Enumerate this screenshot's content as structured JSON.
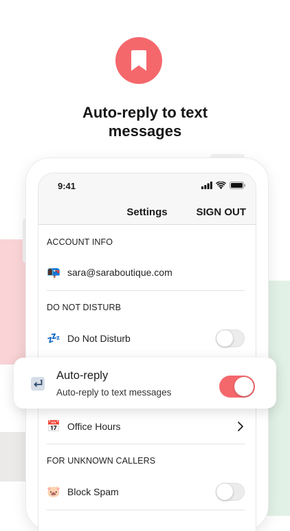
{
  "hero": {
    "icon": "bookmark-icon",
    "accent": "#f4686c",
    "headline_line1": "Auto-reply to text",
    "headline_line2": "messages"
  },
  "status_bar": {
    "time": "9:41",
    "icons": [
      "signal-icon",
      "wifi-icon",
      "battery-icon"
    ]
  },
  "nav": {
    "title": "Settings",
    "right_action": "SIGN OUT"
  },
  "sections": {
    "account_info": {
      "header": "ACCOUNT INFO",
      "email_emoji": "📭",
      "email": "sara@saraboutique.com"
    },
    "do_not_disturb": {
      "header": "DO NOT DISTURB",
      "dnd_emoji": "💤",
      "dnd_label": "Do Not Disturb",
      "office_hours_emoji": "📅",
      "office_hours_label": "Office Hours"
    },
    "unknown_callers": {
      "header": "FOR UNKNOWN CALLERS",
      "block_spam_emoji": "🐷",
      "block_spam_label": "Block Spam"
    }
  },
  "auto_reply_card": {
    "title": "Auto-reply",
    "subtitle": "Auto-reply to text messages",
    "icon": "return-arrow-icon",
    "enabled": true
  },
  "colors": {
    "accent": "#f4686c",
    "bg_pink": "#f9d3d6",
    "bg_green": "#e2f1e6"
  }
}
